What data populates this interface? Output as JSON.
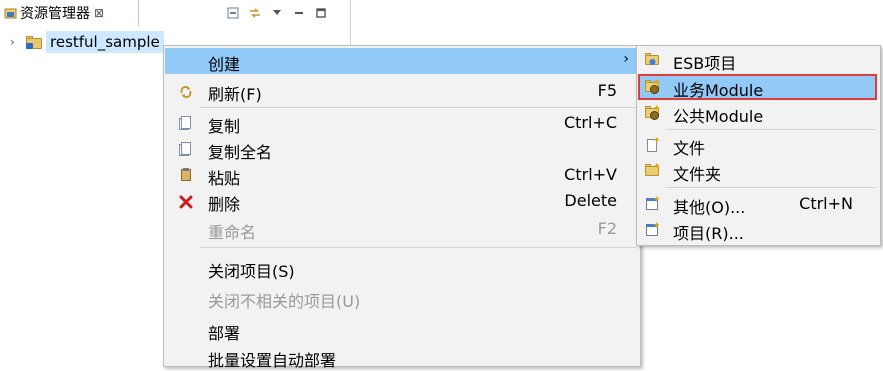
{
  "view": {
    "tab_title": "资源管理器",
    "tab_close": "⊠",
    "tools": [
      "collapse-all-icon",
      "link-with-editor-icon",
      "view-menu-icon",
      "minimize-icon",
      "maximize-icon"
    ],
    "tree": {
      "twisty": "›",
      "project_name": "restful_sample"
    }
  },
  "menu": {
    "items": [
      {
        "label": "创建",
        "accel": "",
        "submenu": true,
        "highlighted": true,
        "enabled": true,
        "icon": ""
      },
      {
        "label": "刷新(F)",
        "accel": "F5",
        "enabled": true,
        "icon": "refresh-icon"
      },
      {
        "label": "复制",
        "accel": "Ctrl+C",
        "enabled": true,
        "icon": "copy-icon"
      },
      {
        "label": "复制全名",
        "accel": "",
        "enabled": true,
        "icon": "copy-qualified-name-icon"
      },
      {
        "label": "粘贴",
        "accel": "Ctrl+V",
        "enabled": true,
        "icon": "paste-icon"
      },
      {
        "label": "删除",
        "accel": "Delete",
        "enabled": true,
        "icon": "delete-icon"
      },
      {
        "label": "重命名",
        "accel": "F2",
        "enabled": false,
        "icon": ""
      },
      {
        "label": "关闭项目(S)",
        "accel": "",
        "enabled": true,
        "icon": ""
      },
      {
        "label": "关闭不相关的项目(U)",
        "accel": "",
        "enabled": false,
        "icon": ""
      },
      {
        "label": "部署",
        "accel": "",
        "enabled": true,
        "icon": ""
      },
      {
        "label": "批量设置自动部署",
        "accel": "",
        "enabled": true,
        "icon": ""
      }
    ],
    "submenu_arrow": "›"
  },
  "submenu": {
    "items": [
      {
        "label": "ESB项目",
        "accel": "",
        "icon": "esb-project-icon"
      },
      {
        "label": "业务Module",
        "accel": "",
        "icon": "business-module-icon",
        "highlighted": true
      },
      {
        "label": "公共Module",
        "accel": "",
        "icon": "common-module-icon"
      },
      {
        "label": "文件",
        "accel": "",
        "icon": "new-file-icon"
      },
      {
        "label": "文件夹",
        "accel": "",
        "icon": "new-folder-icon"
      },
      {
        "label": "其他(O)...",
        "accel": "Ctrl+N",
        "icon": "other-wizard-icon"
      },
      {
        "label": "项目(R)...",
        "accel": "",
        "icon": "new-project-icon"
      }
    ]
  },
  "colors": {
    "highlight": "#91c9f7",
    "selection": "#cde8ff",
    "annotation_box": "#e23b3b",
    "menu_bg": "#f2f2f2",
    "disabled_text": "#9a9a9a"
  }
}
